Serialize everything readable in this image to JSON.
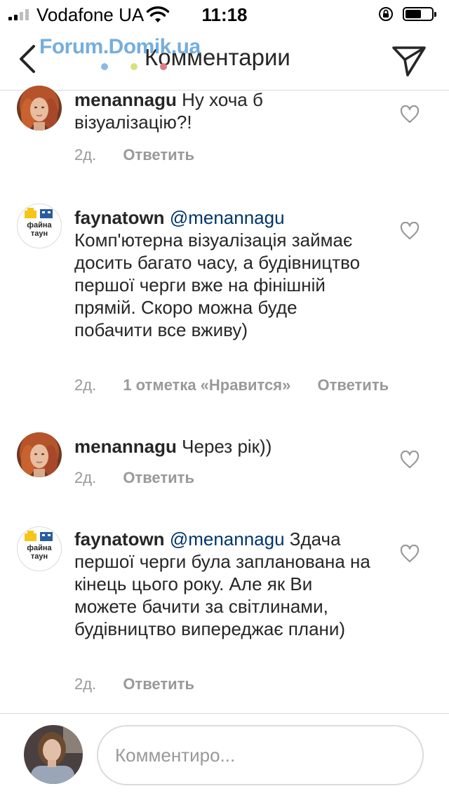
{
  "status_bar": {
    "carrier": "Vodafone UA",
    "time": "11:18",
    "battery_level": 0.6
  },
  "watermark": "Forum.Domik.ua",
  "header": {
    "title": "Комментарии",
    "back_icon": "chevron-left-icon",
    "direct_icon": "paper-plane-icon"
  },
  "comments": [
    {
      "username": "menannagu",
      "mention": "",
      "text": "Ну хоча б візуалізацію?!",
      "time": "2д.",
      "likes": "",
      "reply": "Ответить"
    },
    {
      "username": "faynatown",
      "mention": "@menannagu",
      "text": "Комп'ютерна візуалізація займає досить багато часу, а будівництво першої черги вже на фінішній прямій. Скоро можна буде побачити все вживу)",
      "time": "2д.",
      "likes": "1 отметка «Нравится»",
      "reply": "Ответить"
    },
    {
      "username": "menannagu",
      "mention": "",
      "text": "Через рік))",
      "time": "2д.",
      "likes": "",
      "reply": "Ответить"
    },
    {
      "username": "faynatown",
      "mention": "@menannagu",
      "text": "Здача першої черги була запланована на кінець цього року. Але як Ви можете бачити за світлинами, будівництво випереджає плани)",
      "time": "2д.",
      "likes": "",
      "reply": "Ответить"
    }
  ],
  "logo_text": {
    "line1": "файна",
    "line2": "таун"
  },
  "composer": {
    "placeholder": "Комментиро..."
  },
  "colors": {
    "text": "#262626",
    "secondary": "#999999",
    "mention": "#003569",
    "divider": "#dbdbdb",
    "watermark": "#5ea0d8",
    "logo_yellow": "#f5c518",
    "logo_blue": "#2a5d9f"
  }
}
